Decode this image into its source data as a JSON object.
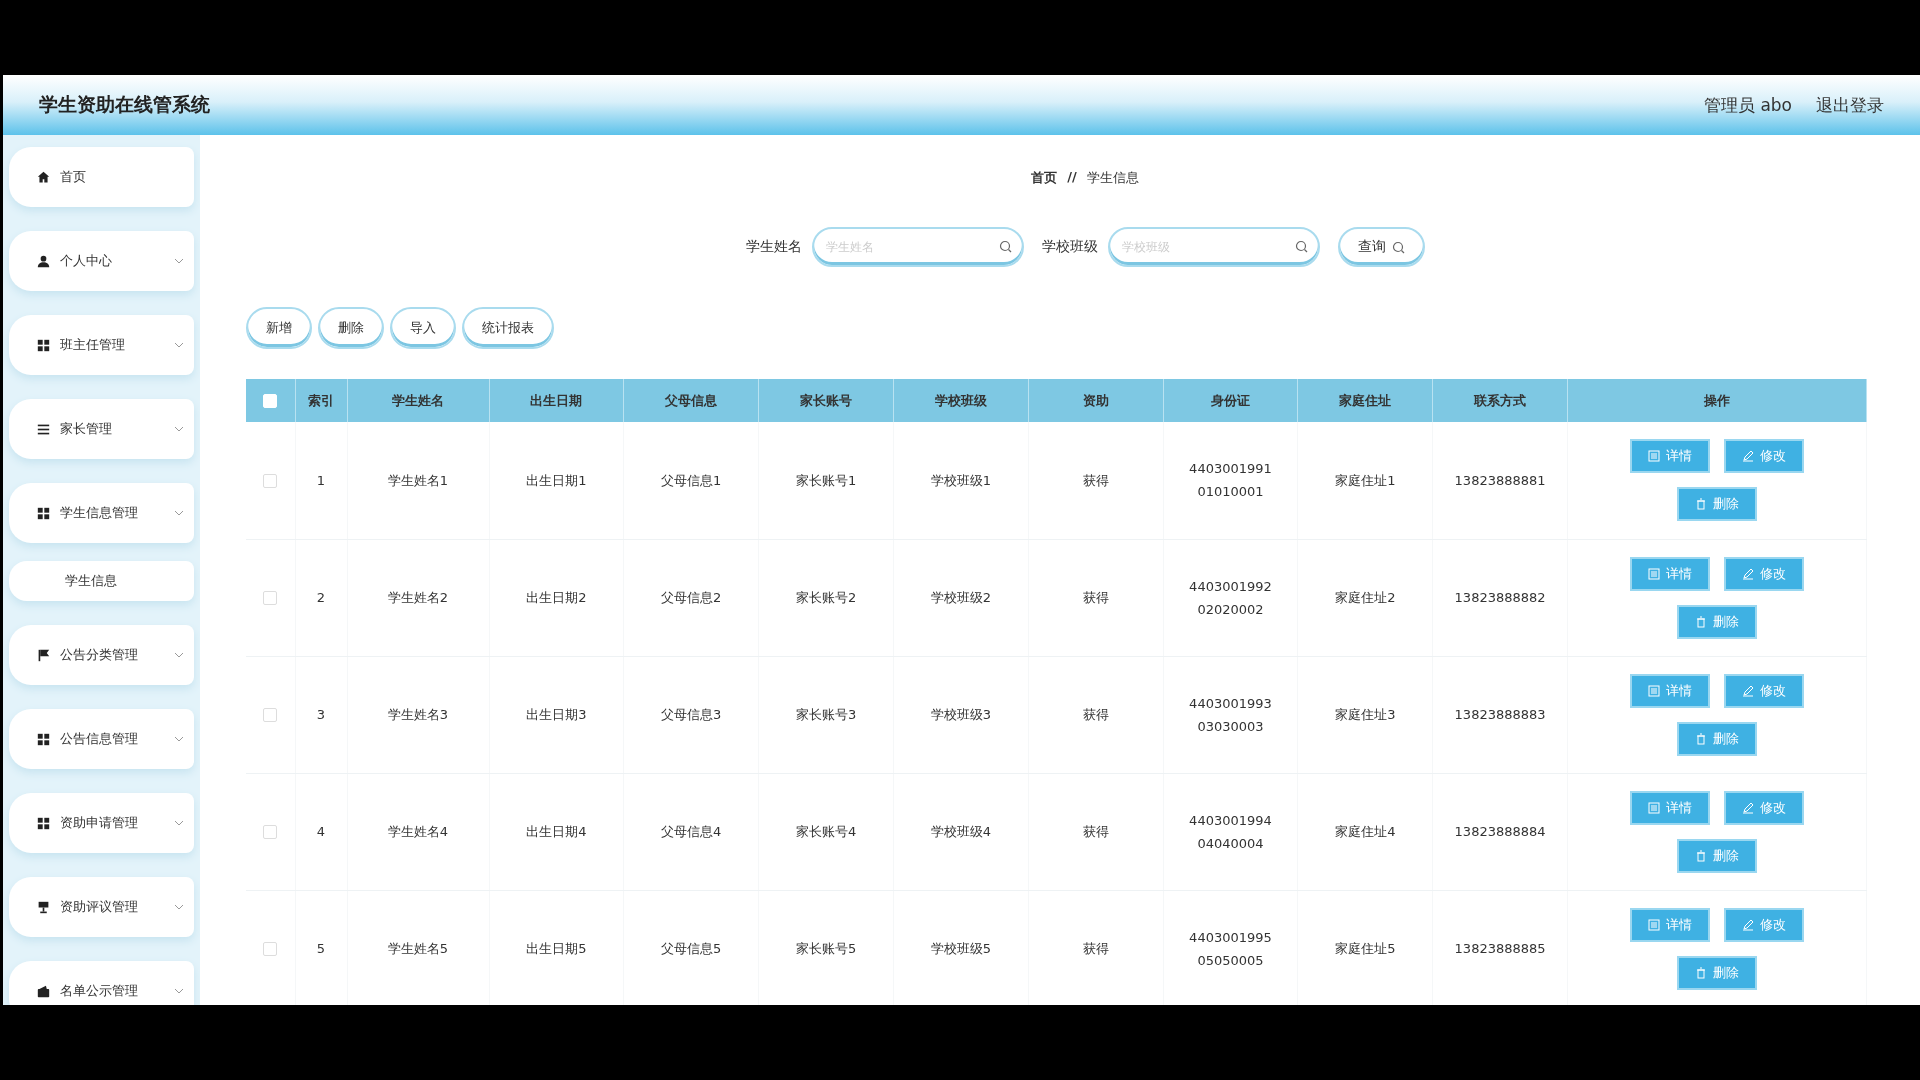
{
  "header": {
    "title": "学生资助在线管系统",
    "user": "管理员 abo",
    "logout": "退出登录"
  },
  "sidebar": {
    "items": [
      {
        "label": "首页",
        "kind": "link"
      },
      {
        "label": "个人中心",
        "kind": "menu"
      },
      {
        "label": "班主任管理",
        "kind": "menu"
      },
      {
        "label": "家长管理",
        "kind": "menu"
      },
      {
        "label": "学生信息管理",
        "kind": "menu",
        "children": [
          {
            "label": "学生信息"
          }
        ]
      },
      {
        "label": "公告分类管理",
        "kind": "menu"
      },
      {
        "label": "公告信息管理",
        "kind": "menu"
      },
      {
        "label": "资助申请管理",
        "kind": "menu"
      },
      {
        "label": "资助评议管理",
        "kind": "menu"
      },
      {
        "label": "名单公示管理",
        "kind": "menu"
      }
    ]
  },
  "breadcrumb": [
    "首页",
    "//",
    "学生信息"
  ],
  "search": {
    "fields": [
      {
        "label": "学生姓名",
        "placeholder": "学生姓名"
      },
      {
        "label": "学校班级",
        "placeholder": "学校班级"
      }
    ],
    "button": "查询"
  },
  "actions": [
    "新增",
    "删除",
    "导入",
    "统计报表"
  ],
  "table": {
    "select_all": {
      "checked": false
    },
    "columns": [
      "索引",
      "学生姓名",
      "出生日期",
      "父母信息",
      "家长账号",
      "学校班级",
      "资助",
      "身份证",
      "家庭住址",
      "联系方式",
      "操作"
    ],
    "rows": [
      {
        "checked": false,
        "cells": [
          "1",
          "学生姓名1",
          "出生日期1",
          "父母信息1",
          "家长账号1",
          "学校班级1",
          "获得",
          "440300199101010001",
          "家庭住址1",
          "13823888881"
        ],
        "buttons": [
          "详情",
          "修改",
          "删除"
        ]
      },
      {
        "checked": false,
        "cells": [
          "2",
          "学生姓名2",
          "出生日期2",
          "父母信息2",
          "家长账号2",
          "学校班级2",
          "获得",
          "440300199202020002",
          "家庭住址2",
          "13823888882"
        ],
        "buttons": [
          "详情",
          "修改",
          "删除"
        ]
      },
      {
        "checked": false,
        "cells": [
          "3",
          "学生姓名3",
          "出生日期3",
          "父母信息3",
          "家长账号3",
          "学校班级3",
          "获得",
          "440300199303030003",
          "家庭住址3",
          "13823888883"
        ],
        "buttons": [
          "详情",
          "修改",
          "删除"
        ]
      },
      {
        "checked": false,
        "cells": [
          "4",
          "学生姓名4",
          "出生日期4",
          "父母信息4",
          "家长账号4",
          "学校班级4",
          "获得",
          "440300199404040004",
          "家庭住址4",
          "13823888884"
        ],
        "buttons": [
          "详情",
          "修改",
          "删除"
        ]
      },
      {
        "checked": false,
        "cells": [
          "5",
          "学生姓名5",
          "出生日期5",
          "父母信息5",
          "家长账号5",
          "学校班级5",
          "获得",
          "440300199505050005",
          "家庭住址5",
          "13823888885"
        ],
        "buttons": [
          "详情",
          "修改",
          "删除"
        ]
      }
    ]
  }
}
